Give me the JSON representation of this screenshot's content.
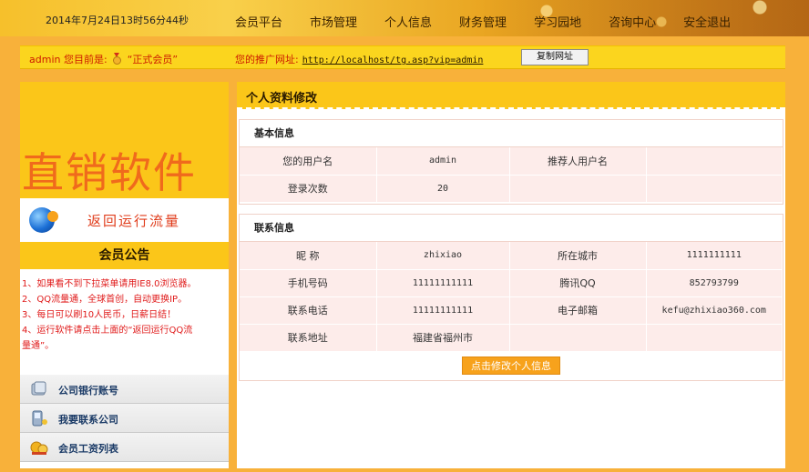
{
  "header": {
    "datetime": "2014年7月24日13时56分44秒",
    "nav": [
      "会员平台",
      "市场管理",
      "个人信息",
      "财务管理",
      "学习园地",
      "咨询中心",
      "安全退出"
    ]
  },
  "status_bar": {
    "user": "admin",
    "level_prefix": "您目前是:",
    "level": "“正式会员”",
    "promo_label": "您的推广网址:",
    "promo_url": "http://localhost/tg.asp?vip=admin",
    "copy_button": "复制网址"
  },
  "sidebar": {
    "banner_text": "直销软件",
    "return_label": "返回运行流量",
    "notice_title": "会员公告",
    "notices": [
      "1、如果看不到下拉菜单请用IE8.0浏览器。",
      "2、QQ流量通，全球首创，自动更换IP。",
      "3、每日可以刷10人民币，日薪日结！",
      "4、运行软件请点击上面的“返回运行QQ流",
      "量通”。"
    ],
    "links": [
      {
        "label": "公司银行账号",
        "icon": "bank-card-icon"
      },
      {
        "label": "我要联系公司",
        "icon": "phone-icon"
      },
      {
        "label": "会员工资列表",
        "icon": "money-icon"
      }
    ]
  },
  "main": {
    "title": "个人资料修改",
    "basic": {
      "title": "基本信息",
      "username_label": "您的用户名",
      "username": "admin",
      "referrer_label": "推荐人用户名",
      "referrer": "",
      "logins_label": "登录次数",
      "logins": "20"
    },
    "contact": {
      "title": "联系信息",
      "nickname_label": "昵  称",
      "nickname": "zhixiao",
      "city_label": "所在城市",
      "city": "1111111111",
      "mobile_label": "手机号码",
      "mobile": "11111111111",
      "qq_label": "腾讯QQ",
      "qq": "852793799",
      "phone_label": "联系电话",
      "phone": "11111111111",
      "email_label": "电子邮箱",
      "email": "kefu@zhixiao360.com",
      "address_label": "联系地址",
      "address": "福建省福州市"
    },
    "submit_button": "点击修改个人信息"
  },
  "colors": {
    "accent": "#fbc619",
    "orange": "#f7a21c",
    "red_text": "#e01a1a",
    "row_bg": "#fdecea"
  }
}
